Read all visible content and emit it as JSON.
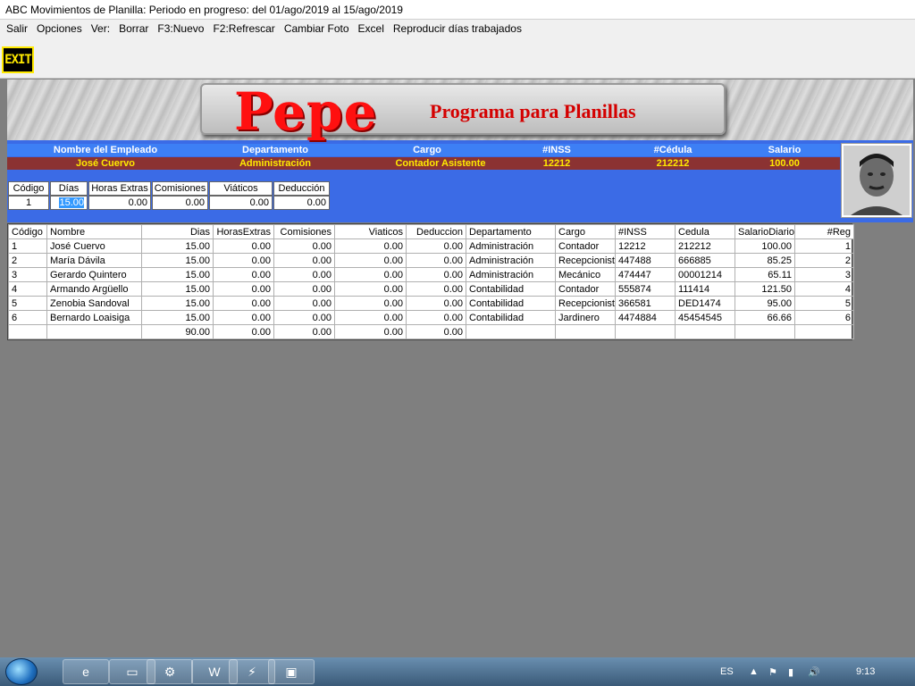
{
  "window": {
    "title": "ABC Movimientos de Planilla: Periodo en progreso: del 01/ago/2019 al 15/ago/2019"
  },
  "menu": [
    "Salir",
    "Opciones",
    "Ver:",
    "Borrar",
    "F3:Nuevo",
    "F2:Refrescar",
    "Cambiar Foto",
    "Excel",
    "Reproducir días trabajados"
  ],
  "toolbar": {
    "exit_label": "EXIT"
  },
  "banner": {
    "title": "Pepe",
    "subtitle": "Programa para Planillas"
  },
  "employee": {
    "headers": [
      "Nombre del Empleado",
      "Departamento",
      "Cargo",
      "#INSS",
      "#Cédula",
      "Salario"
    ],
    "values": [
      "José Cuervo",
      "Administración",
      "Contador Asistente",
      "12212",
      "212212",
      "100.00"
    ]
  },
  "entry": {
    "headers": [
      "Código",
      "Días",
      "Horas Extras",
      "Comisiones",
      "Viáticos",
      "Deducción"
    ],
    "values": [
      "1",
      "15.00",
      "0.00",
      "0.00",
      "0.00",
      "0.00"
    ]
  },
  "grid": {
    "columns": [
      "Código",
      "Nombre",
      "Dias",
      "HorasExtras",
      "Comisiones",
      "Viaticos",
      "Deduccion",
      "Departamento",
      "Cargo",
      "#INSS",
      "Cedula",
      "SalarioDiario",
      "#Reg"
    ],
    "rows": [
      [
        "1",
        "José Cuervo",
        "15.00",
        "0.00",
        "0.00",
        "0.00",
        "0.00",
        "Administración",
        "Contador",
        "12212",
        "212212",
        "100.00",
        "1"
      ],
      [
        "2",
        "María Dávila",
        "15.00",
        "0.00",
        "0.00",
        "0.00",
        "0.00",
        "Administración",
        "Recepcionist",
        "447488",
        "666885",
        "85.25",
        "2"
      ],
      [
        "3",
        "Gerardo Quintero",
        "15.00",
        "0.00",
        "0.00",
        "0.00",
        "0.00",
        "Administración",
        "Mecánico",
        "474447",
        "00001214",
        "65.11",
        "3"
      ],
      [
        "4",
        "Armando Argüello",
        "15.00",
        "0.00",
        "0.00",
        "0.00",
        "0.00",
        "Contabilidad",
        "Contador",
        "555874",
        "111414",
        "121.50",
        "4"
      ],
      [
        "5",
        "Zenobia Sandoval",
        "15.00",
        "0.00",
        "0.00",
        "0.00",
        "0.00",
        "Contabilidad",
        "Recepcionist",
        "366581",
        "DED1474",
        "95.00",
        "5"
      ],
      [
        "6",
        "Bernardo Loaisiga",
        "15.00",
        "0.00",
        "0.00",
        "0.00",
        "0.00",
        "Contabilidad",
        "Jardinero",
        "4474884",
        "45454545",
        "66.66",
        "6"
      ]
    ],
    "totals": [
      "",
      "",
      "90.00",
      "0.00",
      "0.00",
      "0.00",
      "0.00",
      "",
      "",
      "",
      "",
      "",
      ""
    ]
  },
  "taskbar": {
    "lang": "ES",
    "time": "9:13"
  }
}
